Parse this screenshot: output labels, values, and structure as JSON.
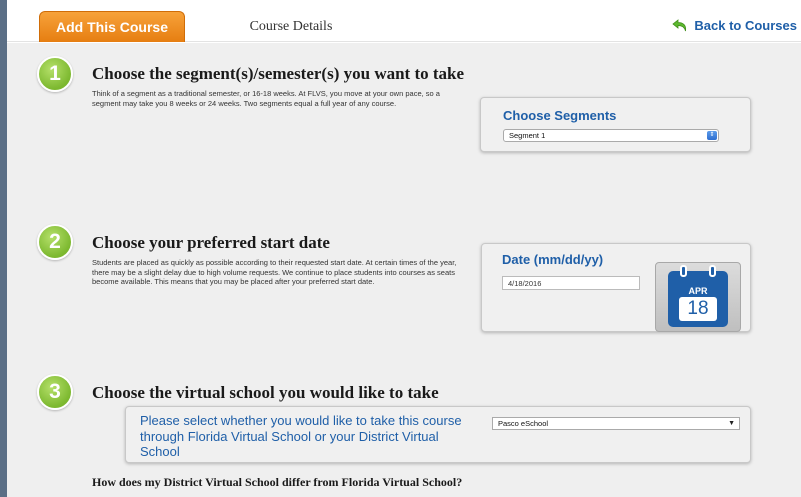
{
  "tabs": {
    "active_label": "Add This Course",
    "inactive_label": "Course Details"
  },
  "header": {
    "back_label": "Back to Courses",
    "back_icon": "back-arrow-icon"
  },
  "colors": {
    "accent_orange": "#e67e11",
    "link_blue": "#1f5fa8",
    "step_green": "#7cb82f"
  },
  "steps": [
    {
      "number": "1",
      "title": "Choose the segment(s)/semester(s) you want to take",
      "description": "Think of a segment as a traditional semester, or 16-18 weeks. At FLVS, you move at your own pace, so a segment may take you 8 weeks or 24 weeks. Two segments equal a full year of any course."
    },
    {
      "number": "2",
      "title": "Choose your preferred start date",
      "description": "Students are placed as quickly as possible according to their requested start date. At certain times of the year, there may be a slight delay due to high volume requests. We continue to place students into courses as seats become available. This means that you may be placed after your preferred start date."
    },
    {
      "number": "3",
      "title": "Choose the virtual school you would like to take"
    }
  ],
  "segments_panel": {
    "title": "Choose Segments",
    "selected": "Segment 1"
  },
  "date_panel": {
    "title": "Date (mm/dd/yy)",
    "value": "4/18/2016",
    "calendar_month": "APR",
    "calendar_day": "18"
  },
  "school_panel": {
    "prompt": "Please select whether you would like to take this course through Florida Virtual School or your District Virtual School",
    "selected": "Pasco eSchool"
  },
  "question": "How does my District Virtual School differ from Florida Virtual School?"
}
